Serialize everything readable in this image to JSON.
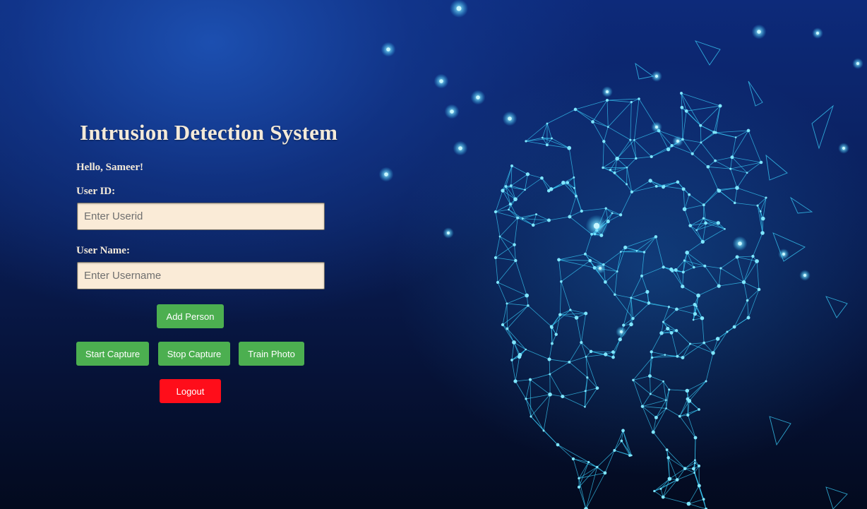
{
  "page": {
    "title": "Intrusion Detection System",
    "greeting": "Hello, Sameer!"
  },
  "form": {
    "userid_label": "User ID:",
    "userid_placeholder": "Enter Userid",
    "userid_value": "",
    "username_label": "User Name:",
    "username_placeholder": "Enter Username",
    "username_value": ""
  },
  "buttons": {
    "add_person": "Add Person",
    "start_capture": "Start Capture",
    "stop_capture": "Stop Capture",
    "train_photo": "Train Photo",
    "logout": "Logout"
  },
  "colors": {
    "button_green": "#4caf50",
    "button_red": "#ff0d1a",
    "input_background": "#faebd7",
    "text_cream": "#f4ead9",
    "network_cyan": "#43d6ff"
  },
  "background": {
    "art_icon": "polygonal-face-network-icon"
  }
}
